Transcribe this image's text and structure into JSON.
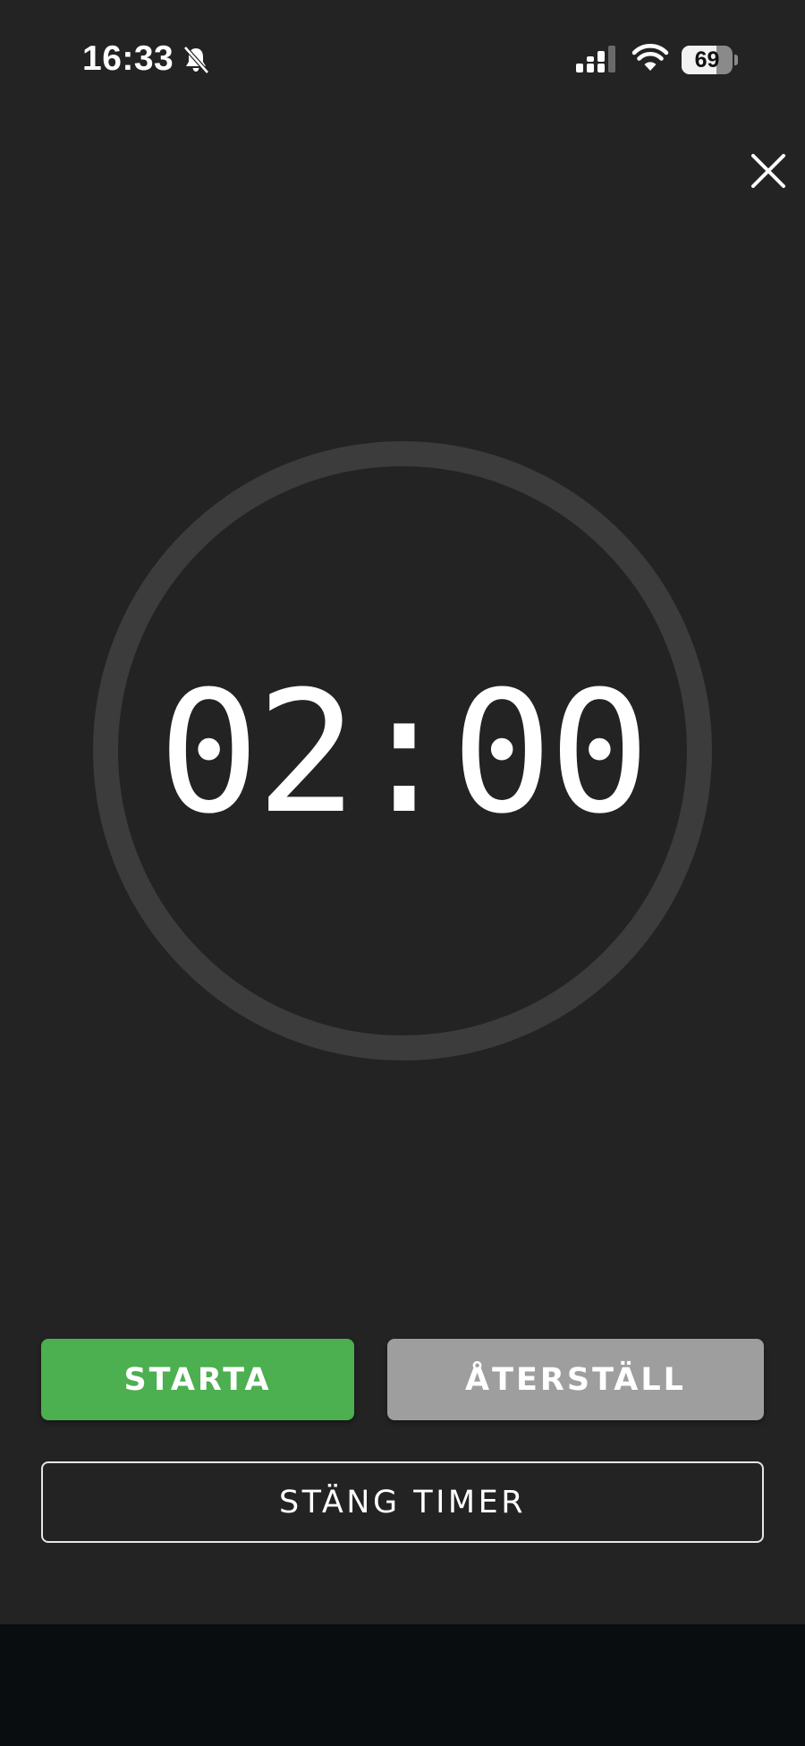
{
  "status_bar": {
    "time": "16:33",
    "battery_level": "69",
    "battery_fraction": 0.69,
    "icons": [
      "bell-slash-icon",
      "cellular-signal-icon",
      "wifi-icon",
      "battery-icon"
    ]
  },
  "header": {
    "close_icon": "close-icon"
  },
  "timer": {
    "display": "02:00"
  },
  "actions": {
    "start_label": "STARTA",
    "reset_label": "ÅTERSTÄLL",
    "close_timer_label": "STÄNG TIMER"
  },
  "colors": {
    "background": "#232323",
    "ring": "#3c3c3c",
    "start": "#4caf50",
    "reset": "#9e9e9e",
    "text": "#ffffff",
    "bottom_bar": "#0a0d10"
  }
}
